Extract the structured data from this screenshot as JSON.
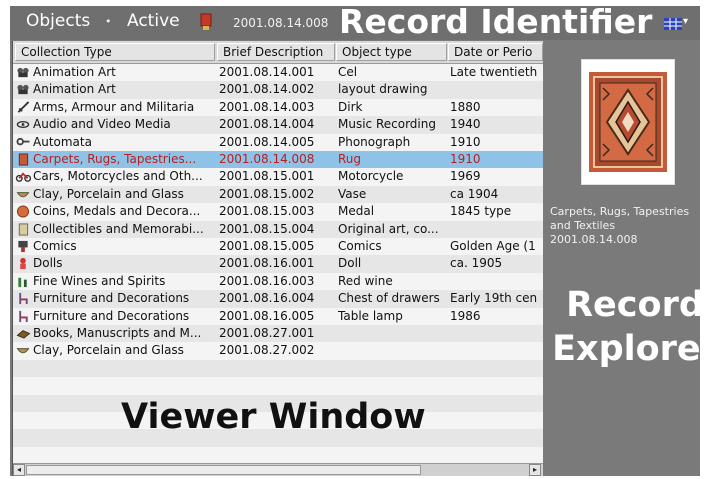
{
  "titlebar": {
    "objects_label": "Objects",
    "separator": "•",
    "active_label": "Active",
    "record_id": "2001.08.14.008",
    "view_arrow": "▾"
  },
  "callouts": {
    "record_identifier": "Record Identifier",
    "viewer_window": "Viewer Window",
    "record_explorer": "Record Explorer"
  },
  "table": {
    "columns": [
      "Collection Type",
      "Brief Description",
      "Object type",
      "Date or Perio"
    ],
    "rows": [
      {
        "icon": "film-camera-icon",
        "collection": "Animation Art",
        "brief": "2001.08.14.001",
        "type": "Cel",
        "date": "Late twentieth"
      },
      {
        "icon": "film-camera-icon",
        "collection": "Animation Art",
        "brief": "2001.08.14.002",
        "type": "layout drawing",
        "date": ""
      },
      {
        "icon": "sword-icon",
        "collection": "Arms, Armour and Militaria",
        "brief": "2001.08.14.003",
        "type": "Dirk",
        "date": "1880"
      },
      {
        "icon": "audio-icon",
        "collection": "Audio and Video Media",
        "brief": "2001.08.14.004",
        "type": "Music Recording",
        "date": "1940"
      },
      {
        "icon": "key-icon",
        "collection": "Automata",
        "brief": "2001.08.14.005",
        "type": "Phonograph",
        "date": "1910"
      },
      {
        "icon": "rug-icon",
        "collection": "Carpets, Rugs, Tapestries...",
        "brief": "2001.08.14.008",
        "type": "Rug",
        "date": "1910",
        "selected": true
      },
      {
        "icon": "motorcycle-icon",
        "collection": "Cars, Motorcycles and Oth...",
        "brief": "2001.08.15.001",
        "type": "Motorcycle",
        "date": "1969"
      },
      {
        "icon": "bowl-icon",
        "collection": "Clay, Porcelain and Glass",
        "brief": "2001.08.15.002",
        "type": "Vase",
        "date": "ca 1904"
      },
      {
        "icon": "coin-icon",
        "collection": "Coins, Medals and Decora...",
        "brief": "2001.08.15.003",
        "type": "Medal",
        "date": "1845 type"
      },
      {
        "icon": "card-icon",
        "collection": "Collectibles and Memorabi...",
        "brief": "2001.08.15.004",
        "type": "Original art, co...",
        "date": ""
      },
      {
        "icon": "comic-icon",
        "collection": "Comics",
        "brief": "2001.08.15.005",
        "type": "Comics",
        "date": "Golden Age (1"
      },
      {
        "icon": "doll-icon",
        "collection": "Dolls",
        "brief": "2001.08.16.001",
        "type": "Doll",
        "date": "ca. 1905"
      },
      {
        "icon": "wine-icon",
        "collection": "Fine Wines and Spirits",
        "brief": "2001.08.16.003",
        "type": "Red wine",
        "date": ""
      },
      {
        "icon": "chair-icon",
        "collection": "Furniture and Decorations",
        "brief": "2001.08.16.004",
        "type": "Chest of drawers",
        "date": "Early 19th cen"
      },
      {
        "icon": "chair-icon",
        "collection": "Furniture and Decorations",
        "brief": "2001.08.16.005",
        "type": "Table lamp",
        "date": "1986"
      },
      {
        "icon": "book-icon",
        "collection": "Books, Manuscripts and M...",
        "brief": "2001.08.27.001",
        "type": "",
        "date": ""
      },
      {
        "icon": "bowl-icon",
        "collection": "Clay, Porcelain and Glass",
        "brief": "2001.08.27.002",
        "type": "",
        "date": ""
      }
    ]
  },
  "scrollbar": {
    "left_arrow": "◂",
    "right_arrow": "▸"
  },
  "explorer": {
    "title": "Carpets, Rugs, Tapestries and Textiles",
    "record_id": "2001.08.14.008",
    "image_icon": "rug-thumbnail-icon"
  },
  "colors": {
    "frame_gray": "#7b7b7b",
    "selection": "#8ec2e6",
    "selected_text": "#b52121",
    "rug_red": "#c45a3a"
  }
}
